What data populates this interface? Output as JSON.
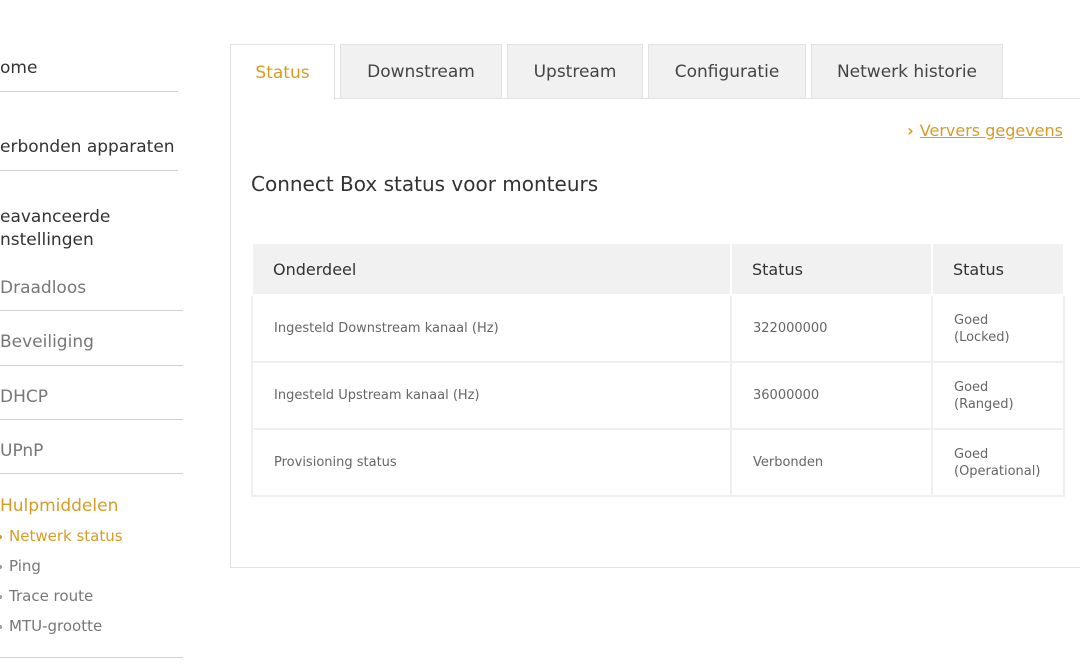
{
  "sidebar": {
    "main_items": [
      {
        "label": "ome"
      },
      {
        "label": "erbonden apparaten"
      },
      {
        "label_line1": "eavanceerde",
        "label_line2": "nstellingen"
      }
    ],
    "sub_items": [
      {
        "label": "Draadloos"
      },
      {
        "label": "Beveiliging"
      },
      {
        "label": "DHCP"
      },
      {
        "label": "UPnP"
      },
      {
        "label": "Hulpmiddelen"
      }
    ],
    "tools": [
      {
        "label": "Netwerk status"
      },
      {
        "label": "Ping"
      },
      {
        "label": "Trace route"
      },
      {
        "label": "MTU-grootte"
      }
    ]
  },
  "tabs": [
    {
      "label": "Status"
    },
    {
      "label": "Downstream"
    },
    {
      "label": "Upstream"
    },
    {
      "label": "Configuratie"
    },
    {
      "label": "Netwerk historie"
    }
  ],
  "panel": {
    "refresh_label": "Ververs gegevens",
    "title": "Connect Box status voor monteurs",
    "table": {
      "headers": [
        "Onderdeel",
        "Status",
        "Status"
      ],
      "rows": [
        {
          "component": "Ingesteld Downstream kanaal (Hz)",
          "value": "322000000",
          "state_line1": "Goed",
          "state_line2": "(Locked)"
        },
        {
          "component": "Ingesteld Upstream kanaal (Hz)",
          "value": "36000000",
          "state_line1": "Goed",
          "state_line2": "(Ranged)"
        },
        {
          "component": "Provisioning status",
          "value": "Verbonden",
          "state_line1": "Goed",
          "state_line2": "(Operational)"
        }
      ]
    }
  },
  "colors": {
    "accent": "#d89c25",
    "tab_bg": "#f1f1f1",
    "border": "#e2e2e2"
  }
}
